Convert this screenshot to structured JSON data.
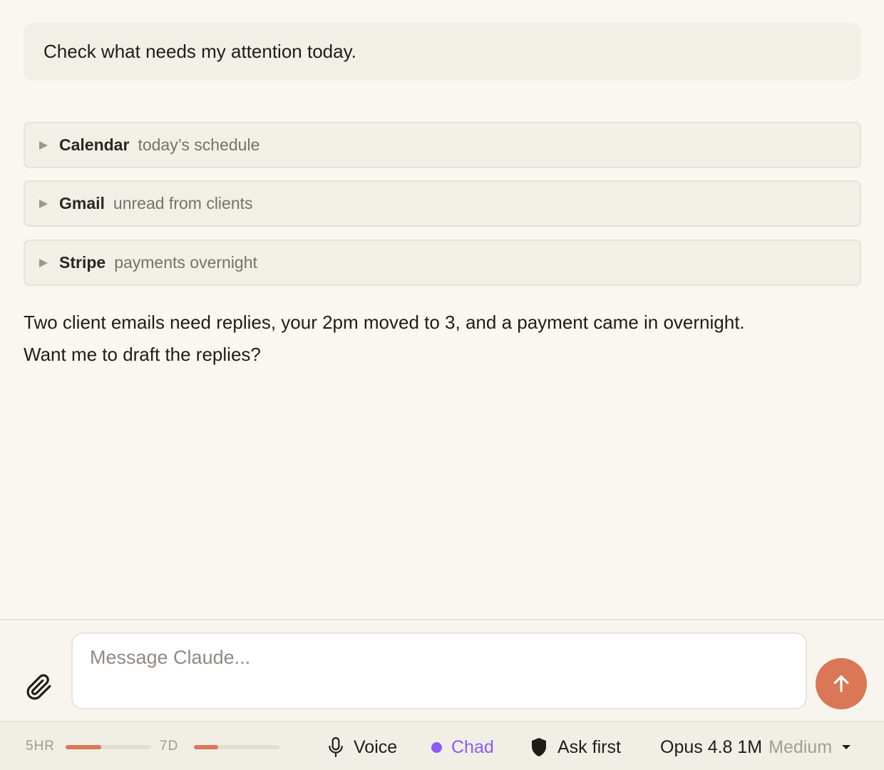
{
  "conversation": {
    "user_message": "Check what needs my attention today.",
    "tool_calls": [
      {
        "name": "Calendar",
        "description": "today’s schedule"
      },
      {
        "name": "Gmail",
        "description": "unread from clients"
      },
      {
        "name": "Stripe",
        "description": "payments overnight"
      }
    ],
    "assistant_message_line1": "Two client emails need replies, your 2pm moved to 3, and a payment came in overnight.",
    "assistant_message_line2": "Want me to draft the replies?"
  },
  "composer": {
    "placeholder": "Message Claude...",
    "attach_icon": "paperclip-icon",
    "send_icon": "arrow-up-icon"
  },
  "status_bar": {
    "usage_5hr_label": "5HR",
    "usage_5hr_fraction": 0.42,
    "usage_7d_label": "7D",
    "usage_7d_fraction": 0.28,
    "voice_label": "Voice",
    "voice_icon": "microphone-icon",
    "persona_label": "Chad",
    "persona_color": "#8b5cf6",
    "permission_label": "Ask first",
    "permission_icon": "shield-icon",
    "model_label": "Opus 4.8 1M",
    "effort_label": "Medium",
    "accent_color": "#d97757"
  }
}
